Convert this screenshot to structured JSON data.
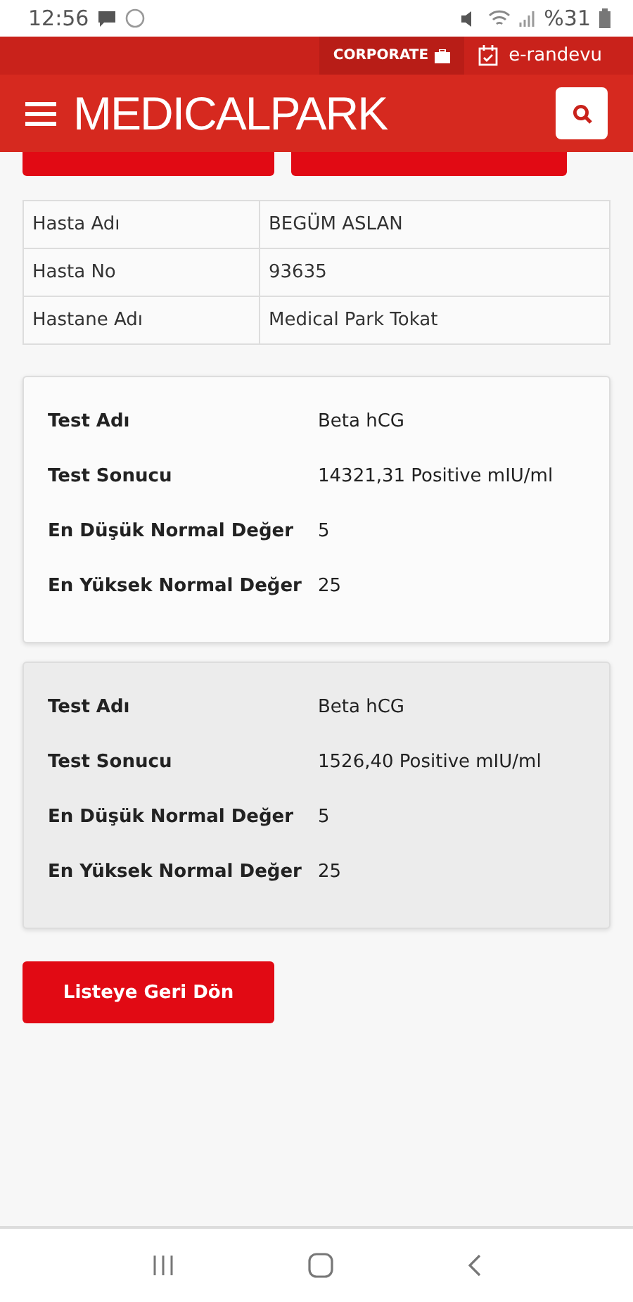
{
  "status_bar": {
    "time": "12:56",
    "battery": "%31"
  },
  "top_bar": {
    "corporate": "CORPORATE",
    "appointment": "e-randevu"
  },
  "header": {
    "logo": "MEDICALPARK"
  },
  "patient_table": {
    "rows": [
      {
        "label": "Hasta Adı",
        "value": "BEGÜM ASLAN"
      },
      {
        "label": "Hasta No",
        "value": "93635"
      },
      {
        "label": "Hastane Adı",
        "value": "Medical Park Tokat"
      }
    ]
  },
  "results": [
    {
      "shaded": false,
      "rows": [
        {
          "label": "Test Adı",
          "value": "Beta hCG"
        },
        {
          "label": "Test Sonucu",
          "value": "14321,31 Positive mIU/ml"
        },
        {
          "label": "En Düşük Normal Değer",
          "value": "5"
        },
        {
          "label": "En Yüksek Normal Değer",
          "value": "25"
        }
      ]
    },
    {
      "shaded": true,
      "rows": [
        {
          "label": "Test Adı",
          "value": "Beta hCG"
        },
        {
          "label": "Test Sonucu",
          "value": "1526,40 Positive mIU/ml"
        },
        {
          "label": "En Düşük Normal Değer",
          "value": "5"
        },
        {
          "label": "En Yüksek Normal Değer",
          "value": "25"
        }
      ]
    }
  ],
  "back_button": "Listeye Geri Dön"
}
